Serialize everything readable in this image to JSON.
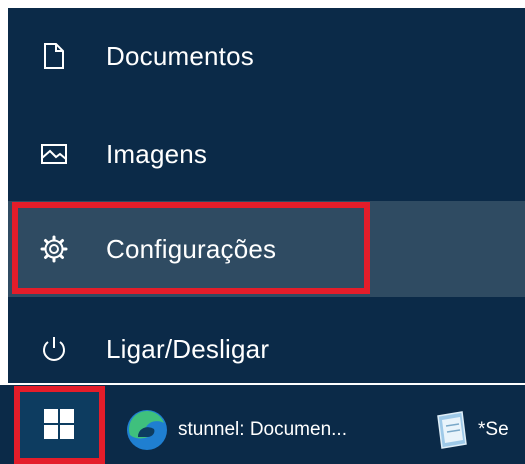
{
  "start_menu": {
    "items": [
      {
        "label": "Documentos",
        "icon": "document-icon"
      },
      {
        "label": "Imagens",
        "icon": "pictures-icon"
      },
      {
        "label": "Configurações",
        "icon": "gear-icon"
      },
      {
        "label": "Ligar/Desligar",
        "icon": "power-icon"
      }
    ]
  },
  "taskbar": {
    "start_icon": "windows-logo-icon",
    "apps": [
      {
        "label": "stunnel: Documen...",
        "icon": "edge-browser-icon"
      },
      {
        "label": "*Se",
        "icon": "notepad-icon"
      }
    ]
  },
  "colors": {
    "menu_background": "#0b2a48",
    "hover_background": "#2f4b62",
    "highlight": "#e41d2a",
    "text": "#ffffff"
  }
}
